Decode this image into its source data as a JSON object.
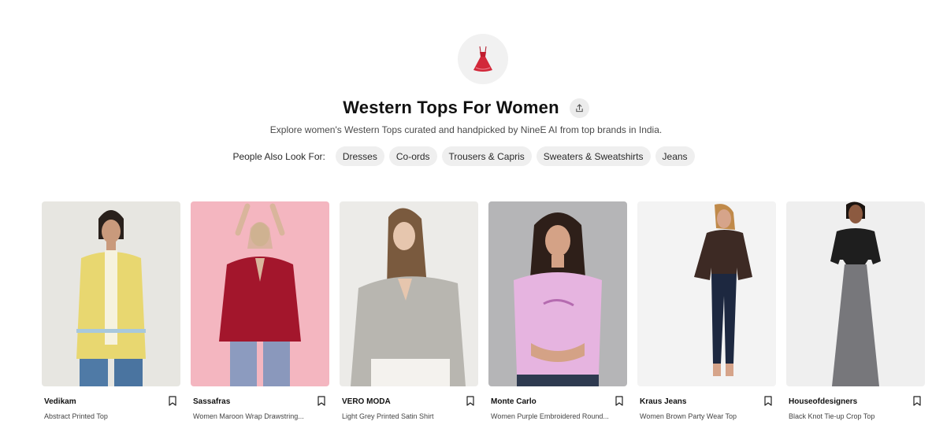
{
  "category": {
    "title": "Western Tops For Women",
    "icon": "red-dress-icon",
    "description": "Explore women's Western Tops curated and handpicked by NineE AI from top brands in India."
  },
  "related": {
    "label": "People Also Look For:",
    "chips": [
      "Dresses",
      "Co-ords",
      "Trousers & Capris",
      "Sweaters & Sweatshirts",
      "Jeans"
    ]
  },
  "products": [
    {
      "brand": "Vedikam",
      "name": "Abstract Printed Top",
      "top_color": "#e8d770",
      "bg": "#e7e6e1"
    },
    {
      "brand": "Sassafras",
      "name": "Women Maroon Wrap Drawstring...",
      "top_color": "#a3162c",
      "bg": "#f4b6c0"
    },
    {
      "brand": "VERO MODA",
      "name": "Light Grey Printed Satin Shirt",
      "top_color": "#b8b6b0",
      "bg": "#ecebe8"
    },
    {
      "brand": "Monte Carlo",
      "name": "Women Purple Embroidered Round...",
      "top_color": "#e6b4e0",
      "bg": "#b5b5b7"
    },
    {
      "brand": "Kraus Jeans",
      "name": "Women Brown Party Wear Top",
      "top_color": "#3d2a24",
      "bg": "#f3f3f3"
    },
    {
      "brand": "Houseofdesigners",
      "name": "Black Knot Tie-up Crop Top",
      "top_color": "#1e1e1e",
      "bg": "#efefef"
    }
  ],
  "icons": {
    "share": "share-icon",
    "bookmark": "bookmark-icon"
  }
}
